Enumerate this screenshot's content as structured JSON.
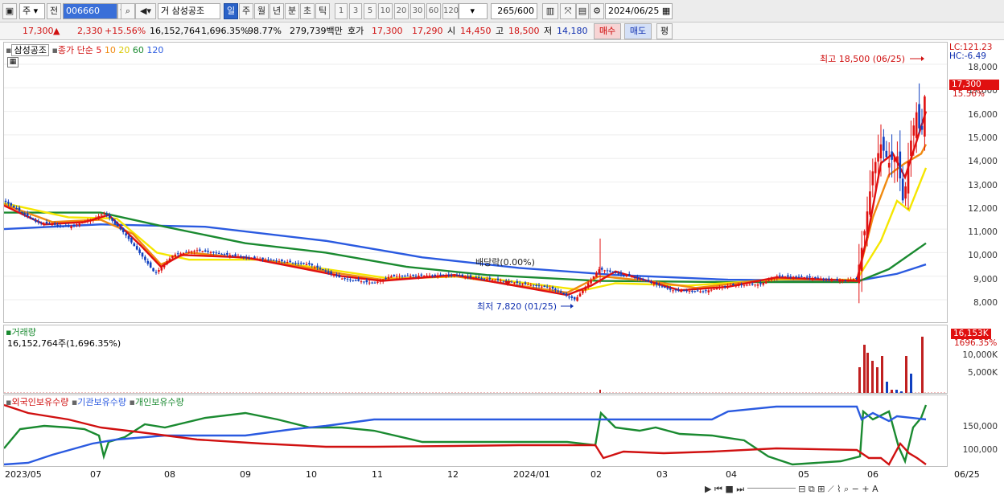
{
  "toolbar": {
    "period_label": "주",
    "prev_label": "전",
    "code": "006660",
    "name_prefix": "거",
    "stock_name": "삼성공조",
    "tabs": [
      "일",
      "주",
      "월",
      "년",
      "분",
      "초",
      "틱"
    ],
    "selected_tab": "일",
    "intervals": [
      "1",
      "3",
      "5",
      "10",
      "20",
      "30",
      "60",
      "120"
    ],
    "count": "265",
    "count_max": "/600",
    "date": "2024/06/25"
  },
  "quote": {
    "price": "17,300",
    "arrow": "▲",
    "change": "2,330",
    "change_pct": "+15.56%",
    "volume": "16,152,764",
    "volume_pct": "1,696.35%",
    "ratio": "98.77%",
    "amount": "279,739백만",
    "ask_label": "호가",
    "ask": "17,300",
    "bid": "17,290",
    "open_label": "시",
    "open": "14,450",
    "high_label": "고",
    "high": "18,500",
    "low_label": "저",
    "low": "14,180",
    "buy_label": "매수",
    "sell_label": "매도",
    "eval_label": "평"
  },
  "price_chart": {
    "legend_name": "삼성공조",
    "legend_ma": "종가 단순",
    "ma_periods": [
      "5",
      "10",
      "20",
      "60",
      "120"
    ],
    "ma_colors": [
      "#e01010",
      "#f08a10",
      "#f0e010",
      "#1a8a30",
      "#2a5ae0"
    ],
    "lc": "LC:121.23",
    "hc": "HC:-6.49",
    "price_tag": "17,300",
    "pct_tag": "15.56%",
    "high_note": "최고 18,500 (06/25)",
    "low_note": "최저 7,820 (01/25)",
    "dividend_note": "배당락(0.00%)",
    "y_ticks": [
      "18,000",
      "17,000",
      "16,000",
      "15,000",
      "14,000",
      "13,000",
      "12,000",
      "11,000",
      "10,000",
      "9,000",
      "8,000"
    ]
  },
  "volume_chart": {
    "title": "거래량",
    "info": "16,152,764주(1,696.35%)",
    "tag": "16,153K",
    "pct": "1696.35%",
    "y_ticks": [
      "10,000K",
      "5,000K"
    ]
  },
  "holding_chart": {
    "legend": [
      "외국인보유수량",
      "기관보유수량",
      "개인보유수량"
    ],
    "legend_colors": [
      "#d01010",
      "#2a5ae0",
      "#1a8a30"
    ],
    "y_ticks": [
      "150,000",
      "100,000"
    ]
  },
  "x_axis": {
    "labels": [
      "2023/05",
      "07",
      "08",
      "09",
      "10",
      "11",
      "12",
      "2024/01",
      "02",
      "03",
      "04",
      "05",
      "06"
    ],
    "right_label": "06/25"
  }
}
